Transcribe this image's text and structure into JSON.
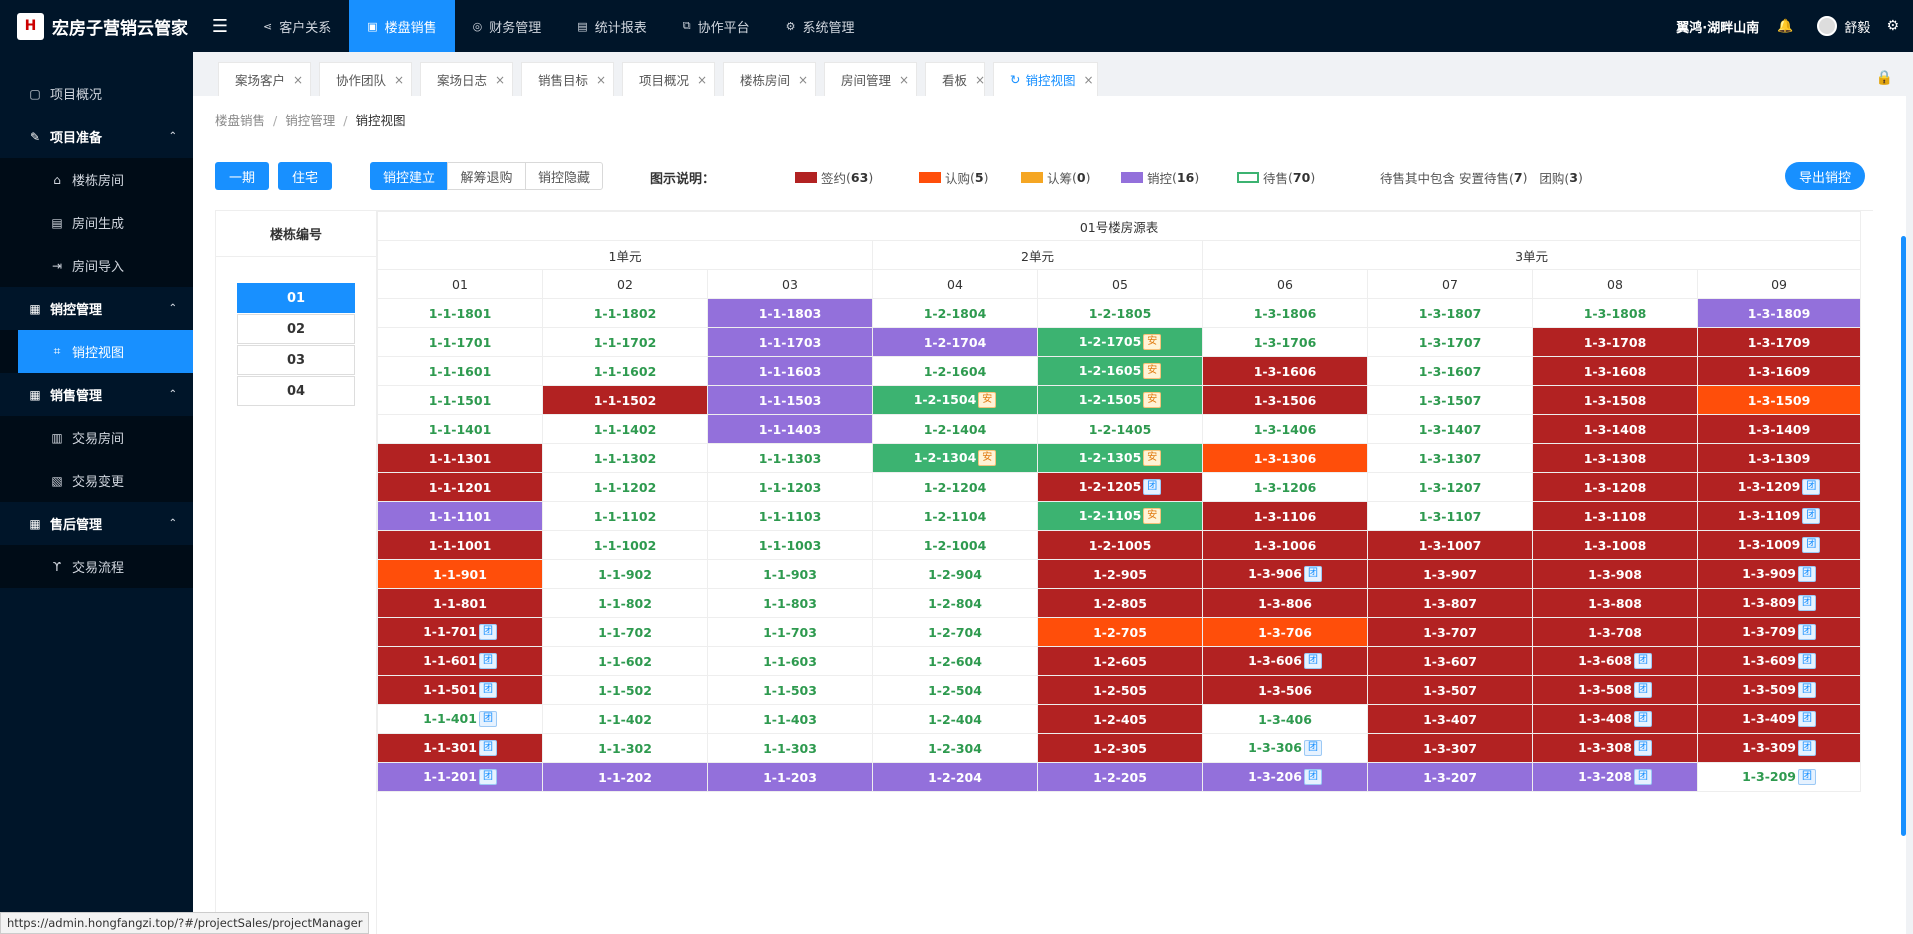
{
  "app": {
    "logo_mark": "H",
    "title": "宏房子营销云管家"
  },
  "topnav": {
    "menu_icon": "menu-fold-icon",
    "items": [
      {
        "label": "客户关系",
        "icon": "share-icon",
        "active": false
      },
      {
        "label": "楼盘销售",
        "icon": "building-icon",
        "active": true
      },
      {
        "label": "财务管理",
        "icon": "finance-icon",
        "active": false
      },
      {
        "label": "统计报表",
        "icon": "report-icon",
        "active": false
      },
      {
        "label": "协作平台",
        "icon": "cooperate-icon",
        "active": false
      },
      {
        "label": "系统管理",
        "icon": "gear-icon",
        "active": false
      }
    ],
    "project": "翼鸿·湖畔山南",
    "user": "舒毅"
  },
  "sidebar": {
    "items": [
      {
        "label": "项目概况",
        "type": "item",
        "icon": "overview-icon"
      },
      {
        "label": "项目准备",
        "type": "group",
        "icon": "edit-icon"
      },
      {
        "label": "楼栋房间",
        "type": "sub",
        "icon": "home-icon"
      },
      {
        "label": "房间生成",
        "type": "sub",
        "icon": "doc-icon"
      },
      {
        "label": "房间导入",
        "type": "sub",
        "icon": "import-icon"
      },
      {
        "label": "销控管理",
        "type": "group",
        "icon": "control-icon"
      },
      {
        "label": "销控视图",
        "type": "active",
        "icon": "view-icon"
      },
      {
        "label": "销售管理",
        "type": "group",
        "icon": "sales-icon"
      },
      {
        "label": "交易房间",
        "type": "sub",
        "icon": "room-icon"
      },
      {
        "label": "交易变更",
        "type": "sub",
        "icon": "change-icon"
      },
      {
        "label": "售后管理",
        "type": "group",
        "icon": "aftersale-icon"
      },
      {
        "label": "交易流程",
        "type": "sub",
        "icon": "flow-icon"
      }
    ]
  },
  "tabs": [
    {
      "label": "案场客户"
    },
    {
      "label": "协作团队"
    },
    {
      "label": "案场日志"
    },
    {
      "label": "销售目标"
    },
    {
      "label": "项目概况"
    },
    {
      "label": "楼栋房间"
    },
    {
      "label": "房间管理"
    },
    {
      "label": "看板"
    },
    {
      "label": "销控视图",
      "active": true
    }
  ],
  "breadcrumb": [
    "楼盘销售",
    "销控管理",
    "销控视图"
  ],
  "toolbar": {
    "phase": "一期",
    "type": "住宅",
    "segments": [
      "销控建立",
      "解筹退购",
      "销控隐藏"
    ],
    "legend_title": "图示说明：",
    "legend": [
      {
        "label": "签约",
        "count": "63",
        "color": "#b22222"
      },
      {
        "label": "认购",
        "count": "5",
        "color": "#ff4e0a"
      },
      {
        "label": "认筹",
        "count": "0",
        "color": "#f5a623"
      },
      {
        "label": "销控",
        "count": "16",
        "color": "#9370db"
      },
      {
        "label": "待售",
        "count": "70",
        "color": "#3cb371"
      }
    ],
    "note_a": "待售其中包含 安置待售(",
    "note_a_count": "7",
    "note_b": "团购(",
    "note_b_count": "3",
    "export": "导出销控"
  },
  "building": {
    "header": "楼栋编号",
    "list": [
      "01",
      "02",
      "03",
      "04"
    ],
    "selected": "01"
  },
  "grid": {
    "title": "01号楼房源表",
    "units": [
      {
        "label": "1单元",
        "cols": 3
      },
      {
        "label": "2单元",
        "cols": 2
      },
      {
        "label": "3单元",
        "cols": 4
      }
    ],
    "cols": [
      "01",
      "02",
      "03",
      "04",
      "05",
      "06",
      "07",
      "08",
      "09"
    ],
    "rows": [
      [
        [
          "1-1-1801",
          "g"
        ],
        [
          "1-1-1802",
          "g"
        ],
        [
          "1-1-1803",
          "c"
        ],
        [
          "1-2-1804",
          "g"
        ],
        [
          "1-2-1805",
          "g"
        ],
        [
          "1-3-1806",
          "g"
        ],
        [
          "1-3-1807",
          "g"
        ],
        [
          "1-3-1808",
          "g"
        ],
        [
          "1-3-1809",
          "c"
        ]
      ],
      [
        [
          "1-1-1701",
          "g"
        ],
        [
          "1-1-1702",
          "g"
        ],
        [
          "1-1-1703",
          "c"
        ],
        [
          "1-2-1704",
          "c"
        ],
        [
          "1-2-1705",
          "p",
          "安"
        ],
        [
          "1-3-1706",
          "g"
        ],
        [
          "1-3-1707",
          "g"
        ],
        [
          "1-3-1708",
          "s"
        ],
        [
          "1-3-1709",
          "s"
        ]
      ],
      [
        [
          "1-1-1601",
          "g"
        ],
        [
          "1-1-1602",
          "g"
        ],
        [
          "1-1-1603",
          "c"
        ],
        [
          "1-2-1604",
          "g"
        ],
        [
          "1-2-1605",
          "p",
          "安"
        ],
        [
          "1-3-1606",
          "s"
        ],
        [
          "1-3-1607",
          "g"
        ],
        [
          "1-3-1608",
          "s"
        ],
        [
          "1-3-1609",
          "s"
        ]
      ],
      [
        [
          "1-1-1501",
          "g"
        ],
        [
          "1-1-1502",
          "s"
        ],
        [
          "1-1-1503",
          "c"
        ],
        [
          "1-2-1504",
          "p",
          "安"
        ],
        [
          "1-2-1505",
          "p",
          "安"
        ],
        [
          "1-3-1506",
          "s"
        ],
        [
          "1-3-1507",
          "g"
        ],
        [
          "1-3-1508",
          "s"
        ],
        [
          "1-3-1509",
          "r"
        ]
      ],
      [
        [
          "1-1-1401",
          "g"
        ],
        [
          "1-1-1402",
          "g"
        ],
        [
          "1-1-1403",
          "c"
        ],
        [
          "1-2-1404",
          "g"
        ],
        [
          "1-2-1405",
          "g"
        ],
        [
          "1-3-1406",
          "g"
        ],
        [
          "1-3-1407",
          "g"
        ],
        [
          "1-3-1408",
          "s"
        ],
        [
          "1-3-1409",
          "s"
        ]
      ],
      [
        [
          "1-1-1301",
          "s"
        ],
        [
          "1-1-1302",
          "g"
        ],
        [
          "1-1-1303",
          "g"
        ],
        [
          "1-2-1304",
          "p",
          "安"
        ],
        [
          "1-2-1305",
          "p",
          "安"
        ],
        [
          "1-3-1306",
          "r"
        ],
        [
          "1-3-1307",
          "g"
        ],
        [
          "1-3-1308",
          "s"
        ],
        [
          "1-3-1309",
          "s"
        ]
      ],
      [
        [
          "1-1-1201",
          "s"
        ],
        [
          "1-1-1202",
          "g"
        ],
        [
          "1-1-1203",
          "g"
        ],
        [
          "1-2-1204",
          "g"
        ],
        [
          "1-2-1205",
          "s",
          "团"
        ],
        [
          "1-3-1206",
          "g"
        ],
        [
          "1-3-1207",
          "g"
        ],
        [
          "1-3-1208",
          "s"
        ],
        [
          "1-3-1209",
          "s",
          "团"
        ]
      ],
      [
        [
          "1-1-1101",
          "c"
        ],
        [
          "1-1-1102",
          "g"
        ],
        [
          "1-1-1103",
          "g"
        ],
        [
          "1-2-1104",
          "g"
        ],
        [
          "1-2-1105",
          "p",
          "安"
        ],
        [
          "1-3-1106",
          "s"
        ],
        [
          "1-3-1107",
          "g"
        ],
        [
          "1-3-1108",
          "s"
        ],
        [
          "1-3-1109",
          "s",
          "团"
        ]
      ],
      [
        [
          "1-1-1001",
          "s"
        ],
        [
          "1-1-1002",
          "g"
        ],
        [
          "1-1-1003",
          "g"
        ],
        [
          "1-2-1004",
          "g"
        ],
        [
          "1-2-1005",
          "s"
        ],
        [
          "1-3-1006",
          "s"
        ],
        [
          "1-3-1007",
          "s"
        ],
        [
          "1-3-1008",
          "s"
        ],
        [
          "1-3-1009",
          "s",
          "团"
        ]
      ],
      [
        [
          "1-1-901",
          "r"
        ],
        [
          "1-1-902",
          "g"
        ],
        [
          "1-1-903",
          "g"
        ],
        [
          "1-2-904",
          "g"
        ],
        [
          "1-2-905",
          "s"
        ],
        [
          "1-3-906",
          "s",
          "团"
        ],
        [
          "1-3-907",
          "s"
        ],
        [
          "1-3-908",
          "s"
        ],
        [
          "1-3-909",
          "s",
          "团"
        ]
      ],
      [
        [
          "1-1-801",
          "s"
        ],
        [
          "1-1-802",
          "g"
        ],
        [
          "1-1-803",
          "g"
        ],
        [
          "1-2-804",
          "g"
        ],
        [
          "1-2-805",
          "s"
        ],
        [
          "1-3-806",
          "s"
        ],
        [
          "1-3-807",
          "s"
        ],
        [
          "1-3-808",
          "s"
        ],
        [
          "1-3-809",
          "s",
          "团"
        ]
      ],
      [
        [
          "1-1-701",
          "s",
          "团"
        ],
        [
          "1-1-702",
          "g"
        ],
        [
          "1-1-703",
          "g"
        ],
        [
          "1-2-704",
          "g"
        ],
        [
          "1-2-705",
          "r"
        ],
        [
          "1-3-706",
          "r"
        ],
        [
          "1-3-707",
          "s"
        ],
        [
          "1-3-708",
          "s"
        ],
        [
          "1-3-709",
          "s",
          "团"
        ]
      ],
      [
        [
          "1-1-601",
          "s",
          "团"
        ],
        [
          "1-1-602",
          "g"
        ],
        [
          "1-1-603",
          "g"
        ],
        [
          "1-2-604",
          "g"
        ],
        [
          "1-2-605",
          "s"
        ],
        [
          "1-3-606",
          "s",
          "团"
        ],
        [
          "1-3-607",
          "s"
        ],
        [
          "1-3-608",
          "s",
          "团"
        ],
        [
          "1-3-609",
          "s",
          "团"
        ]
      ],
      [
        [
          "1-1-501",
          "s",
          "团"
        ],
        [
          "1-1-502",
          "g"
        ],
        [
          "1-1-503",
          "g"
        ],
        [
          "1-2-504",
          "g"
        ],
        [
          "1-2-505",
          "s"
        ],
        [
          "1-3-506",
          "s"
        ],
        [
          "1-3-507",
          "s"
        ],
        [
          "1-3-508",
          "s",
          "团"
        ],
        [
          "1-3-509",
          "s",
          "团"
        ]
      ],
      [
        [
          "1-1-401",
          "g",
          "团"
        ],
        [
          "1-1-402",
          "g"
        ],
        [
          "1-1-403",
          "g"
        ],
        [
          "1-2-404",
          "g"
        ],
        [
          "1-2-405",
          "s"
        ],
        [
          "1-3-406",
          "g"
        ],
        [
          "1-3-407",
          "s"
        ],
        [
          "1-3-408",
          "s",
          "团"
        ],
        [
          "1-3-409",
          "s",
          "团"
        ]
      ],
      [
        [
          "1-1-301",
          "s",
          "团"
        ],
        [
          "1-1-302",
          "g"
        ],
        [
          "1-1-303",
          "g"
        ],
        [
          "1-2-304",
          "g"
        ],
        [
          "1-2-305",
          "s"
        ],
        [
          "1-3-306",
          "g",
          "团"
        ],
        [
          "1-3-307",
          "s"
        ],
        [
          "1-3-308",
          "s",
          "团"
        ],
        [
          "1-3-309",
          "s",
          "团"
        ]
      ],
      [
        [
          "1-1-201",
          "c",
          "团"
        ],
        [
          "1-1-202",
          "c"
        ],
        [
          "1-1-203",
          "c"
        ],
        [
          "1-2-204",
          "c"
        ],
        [
          "1-2-205",
          "c"
        ],
        [
          "1-3-206",
          "c",
          "团"
        ],
        [
          "1-3-207",
          "c"
        ],
        [
          "1-3-208",
          "c",
          "团"
        ],
        [
          "1-3-209",
          "g",
          "团"
        ]
      ]
    ]
  },
  "statusbar": "https://admin.hongfangzi.top/?#/projectSales/projectManager"
}
